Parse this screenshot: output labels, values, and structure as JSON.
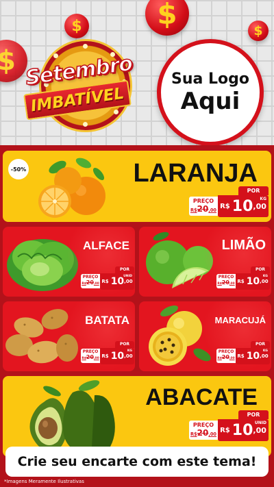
{
  "header": {
    "campaign_title": "Setembro",
    "campaign_subtitle": "IMBATÍVEL",
    "logo_line1": "Sua Logo",
    "logo_line2": "Aqui",
    "coin_symbol": "$"
  },
  "products": {
    "laranja": {
      "name": "LARANJA",
      "discount": "-50%",
      "tag": {
        "por": "POR",
        "preco": "PREÇO",
        "old_prefix": "R$",
        "old_int": "20",
        "old_dec": ",00",
        "currency": "R$",
        "price_int": "10",
        "price_dec": ",00",
        "unit": "KG"
      }
    },
    "alface": {
      "name": "ALFACE",
      "tag": {
        "por": "POR",
        "preco": "PREÇO",
        "old_prefix": "R$",
        "old_int": "20",
        "old_dec": ",00",
        "currency": "R$",
        "price_int": "10",
        "price_dec": ",00",
        "unit": "UNID"
      }
    },
    "limao": {
      "name": "LIMÃO",
      "tag": {
        "por": "POR",
        "preco": "PREÇO",
        "old_prefix": "R$",
        "old_int": "20",
        "old_dec": ",00",
        "currency": "R$",
        "price_int": "10",
        "price_dec": ",00",
        "unit": "KG"
      }
    },
    "batata": {
      "name": "BATATA",
      "tag": {
        "por": "POR",
        "preco": "PREÇO",
        "old_prefix": "R$",
        "old_int": "20",
        "old_dec": ",00",
        "currency": "R$",
        "price_int": "10",
        "price_dec": ",00",
        "unit": "KG"
      }
    },
    "maracuja": {
      "name": "MARACUJÁ",
      "tag": {
        "por": "POR",
        "preco": "PREÇO",
        "old_prefix": "R$",
        "old_int": "20",
        "old_dec": ",00",
        "currency": "R$",
        "price_int": "10",
        "price_dec": ",00",
        "unit": "KG"
      }
    },
    "abacate": {
      "name": "ABACATE",
      "tag": {
        "por": "POR",
        "preco": "PREÇO",
        "old_prefix": "R$",
        "old_int": "20",
        "old_dec": ",00",
        "currency": "R$",
        "price_int": "10",
        "price_dec": ",00",
        "unit": "UNID"
      }
    }
  },
  "footer": {
    "cta": "Crie seu encarte com este tema!",
    "disclaimer": "*Imagens Meramente Ilustrativas"
  },
  "colors": {
    "red": "#e3151f",
    "dark_red": "#b3121a",
    "yellow": "#fbc710",
    "white": "#ffffff"
  }
}
